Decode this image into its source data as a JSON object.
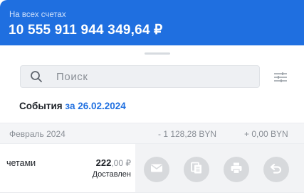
{
  "header": {
    "label": "На всех счетах",
    "amount": "10 555 911 944 349,64 ₽"
  },
  "search": {
    "placeholder": "Поиск"
  },
  "events": {
    "title": "События",
    "date": "за 26.02.2024"
  },
  "month": {
    "label": "Февраль 2024",
    "outgoing": "- 1 128,28 BYN",
    "incoming": "+ 0,00 BYN"
  },
  "transaction": {
    "title": "четами",
    "amount_whole": "222",
    "amount_cents": ",00 ₽",
    "status": "Доставлен"
  },
  "actions": {
    "icons": [
      "mail-icon",
      "copy-icon",
      "print-icon",
      "undo-icon"
    ]
  },
  "colors": {
    "brand_blue": "#1f6fe0",
    "action_button": "#d7d9dc"
  }
}
